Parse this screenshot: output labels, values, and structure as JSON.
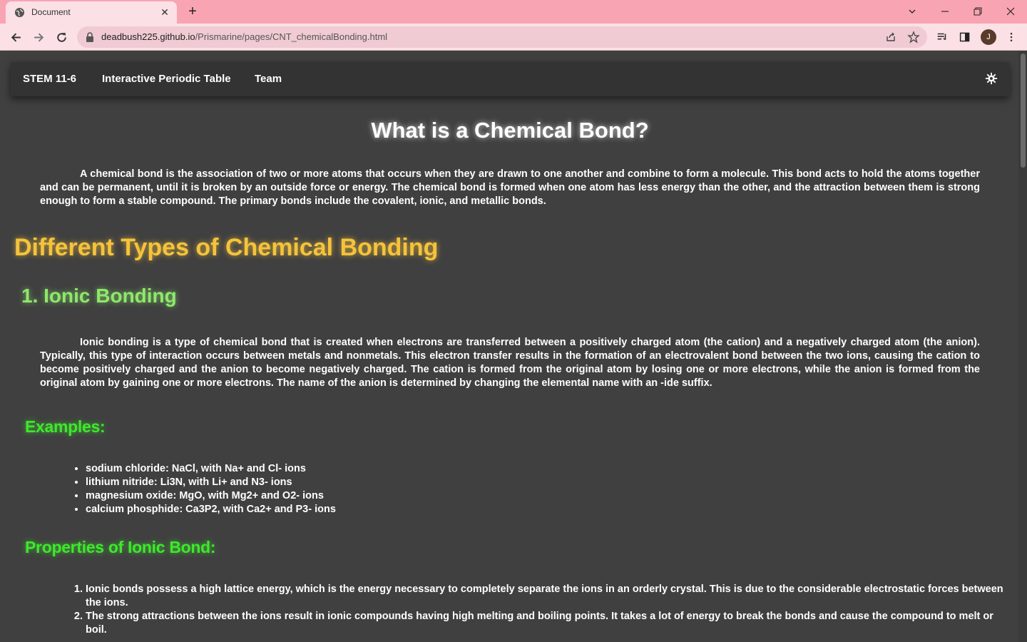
{
  "browser": {
    "tab_title": "Document",
    "url_host": "deadbush225.github.io",
    "url_path": "/Prismarine/pages/CNT_chemicalBonding.html",
    "profile_initial": "J"
  },
  "navbar": {
    "links": [
      "STEM 11-6",
      "Interactive Periodic Table",
      "Team"
    ]
  },
  "content": {
    "title": "What is a Chemical Bond?",
    "intro": "A chemical bond is the association of two or more atoms that occurs when they are drawn to one another and combine to form a molecule. This bond acts to hold the atoms together and can be permanent, until it is broken by an outside force or energy. The chemical bond is formed when one atom has less energy than the other, and the attraction between them is strong enough to form a stable compound. The primary bonds include the covalent, ionic, and metallic bonds.",
    "types_heading": "Different Types of Chemical Bonding",
    "ionic_heading": "1. Ionic Bonding",
    "ionic_text": "Ionic bonding is a type of chemical bond that is created when electrons are transferred between a positively charged atom (the cation) and a negatively charged atom (the anion). Typically, this type of interaction occurs between metals and nonmetals. This electron transfer results in the formation of an electrovalent bond between the two ions, causing the cation to become positively charged and the anion to become negatively charged. The cation is formed from the original atom by losing one or more electrons, while the anion is formed from the original atom by gaining one or more electrons. The name of the anion is determined by changing the elemental name with an -ide suffix.",
    "examples_heading": "Examples:",
    "examples": [
      "sodium chloride: NaCl, with Na+ and Cl- ions",
      "lithium nitride: Li3N, with Li+ and N3- ions",
      "magnesium oxide: MgO, with Mg2+ and O2- ions",
      "calcium phosphide: Ca3P2, with Ca2+ and P3- ions"
    ],
    "properties_heading": "Properties of Ionic Bond:",
    "properties": [
      "Ionic bonds possess a high lattice energy, which is the energy necessary to completely separate the ions in an orderly crystal. This is due to the considerable electrostatic forces between the ions.",
      "The strong attractions between the ions result in ionic compounds having high melting and boiling points. It takes a lot of energy to break the bonds and cause the compound to melt or boil."
    ]
  },
  "colors": {
    "page_bg": "#404040",
    "navbar_bg": "#333333",
    "heading_yellow": "#f5c33b",
    "heading_light_green": "#8ee86b",
    "heading_green": "#3ee82c",
    "browser_tabbar": "#f9a4b3"
  }
}
